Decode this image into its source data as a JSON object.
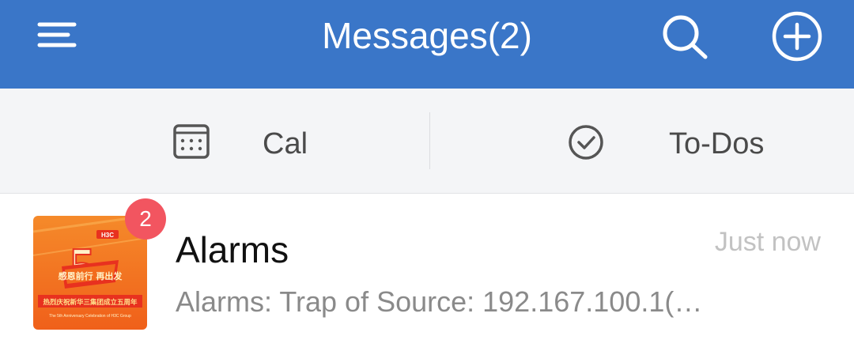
{
  "header": {
    "title": "Messages(2)",
    "menu_icon": "menu-icon",
    "search_icon": "search-icon",
    "add_icon": "add-circle-icon",
    "background_color": "#3a76c8"
  },
  "tabs": [
    {
      "label": "Cal",
      "icon": "calendar-icon"
    },
    {
      "label": "To-Dos",
      "icon": "check-circle-icon"
    }
  ],
  "messages": [
    {
      "name": "Alarms",
      "time": "Just now",
      "preview": "Alarms: Trap of Source: 192.167.100.1(…",
      "unread_count": "2",
      "avatar": {
        "badge_text": "H3C",
        "banner_text": "热烈庆祝新华三集团成立五周年",
        "footer_text": "The 5th Anniversary Celebration of H3C Group",
        "headline_text": "感恩前行 再出发"
      }
    }
  ],
  "colors": {
    "accent": "#3a76c8",
    "badge": "#f25560",
    "avatar_orange": "#f26b1d"
  }
}
